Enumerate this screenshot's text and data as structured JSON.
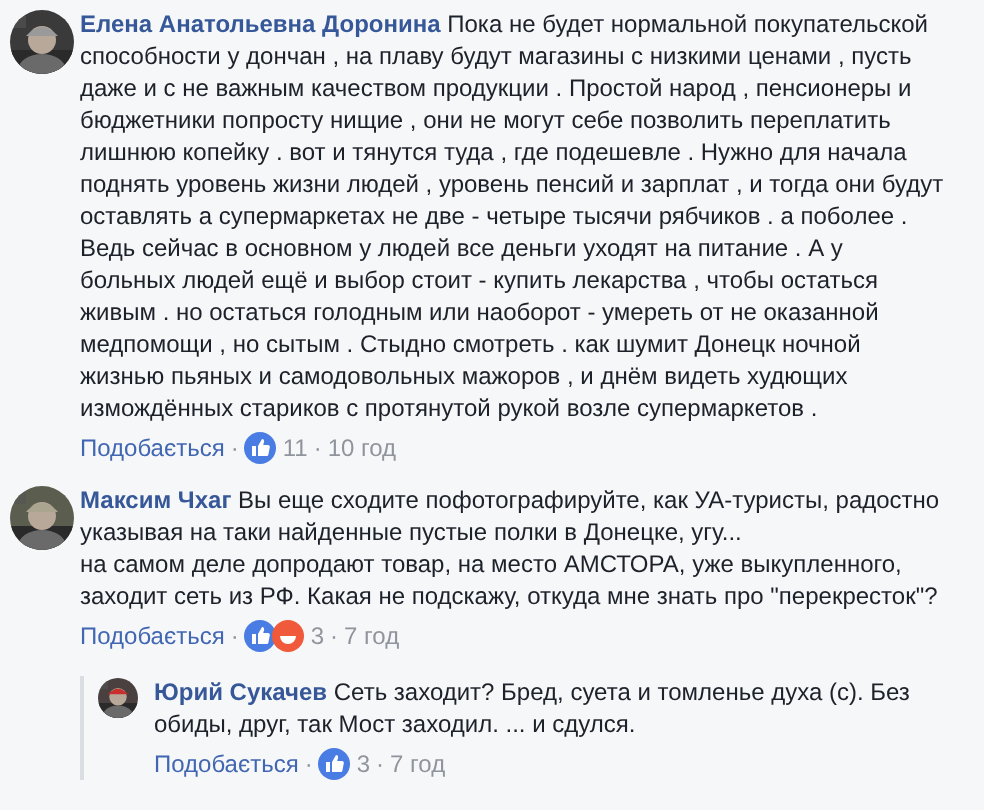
{
  "comments": [
    {
      "author": "Елена Анатольевна Доронина",
      "text": "Пока не будет нормальной покупательской способности у дончан , на плаву будут магазины с низкими ценами , пусть даже и с не важным качеством продукции . Простой народ , пенсионеры и бюджетники попросту нищие , они не могут себе позволить переплатить лишнюю копейку . вот и тянутся туда , где подешевле . Нужно для начала поднять уровень жизни людей , уровень пенсий и зарплат , и тогда они будут оставлять а супермаркетах не две - четыре тысячи рябчиков . а поболее . Ведь сейчас в основном у людей все деньги уходят на питание . А у больных людей ещё и выбор стоит - купить лекарства , чтобы остаться живым . но остаться голодным или наоборот - умереть от не оказанной медпомощи , но сытым . Стыдно смотреть . как шумит Донецк ночной жизнью пьяных и самодовольных мажоров , и днём видеть худющих измождённых стариков с протянутой рукой возле супермаркетов .",
      "footer": {
        "like": "Подобається",
        "dot1": "·",
        "reactions": [
          {
            "kind": "like"
          }
        ],
        "count": "11",
        "dot2": "·",
        "time": "10 год"
      }
    },
    {
      "author": "Максим Чхаг",
      "text": "Вы еще сходите пофотографируйте, как УА-туристы, радостно указывая на таки найденные пустые полки в Донецке, угу...\nна самом деле допродают товар, на место АМСТОРА, уже выкупленного, заходит сеть из РФ. Какая не подскажу, откуда мне знать про \"перекресток\"?",
      "footer": {
        "like": "Подобається",
        "dot1": "·",
        "reactions": [
          {
            "kind": "like"
          },
          {
            "kind": "haha"
          }
        ],
        "count": "3",
        "dot2": "·",
        "time": "7 год"
      },
      "children": [
        {
          "author": "Юрий Сукачев",
          "text": "Сеть заходит? Бред, суета и томленье духа (с). Без обиды, друг, так Мост заходил. ... и сдулся.",
          "footer": {
            "like": "Подобається",
            "dot1": "·",
            "reactions": [
              {
                "kind": "like"
              }
            ],
            "count": "3",
            "dot2": "·",
            "time": "7 год"
          }
        }
      ]
    }
  ]
}
